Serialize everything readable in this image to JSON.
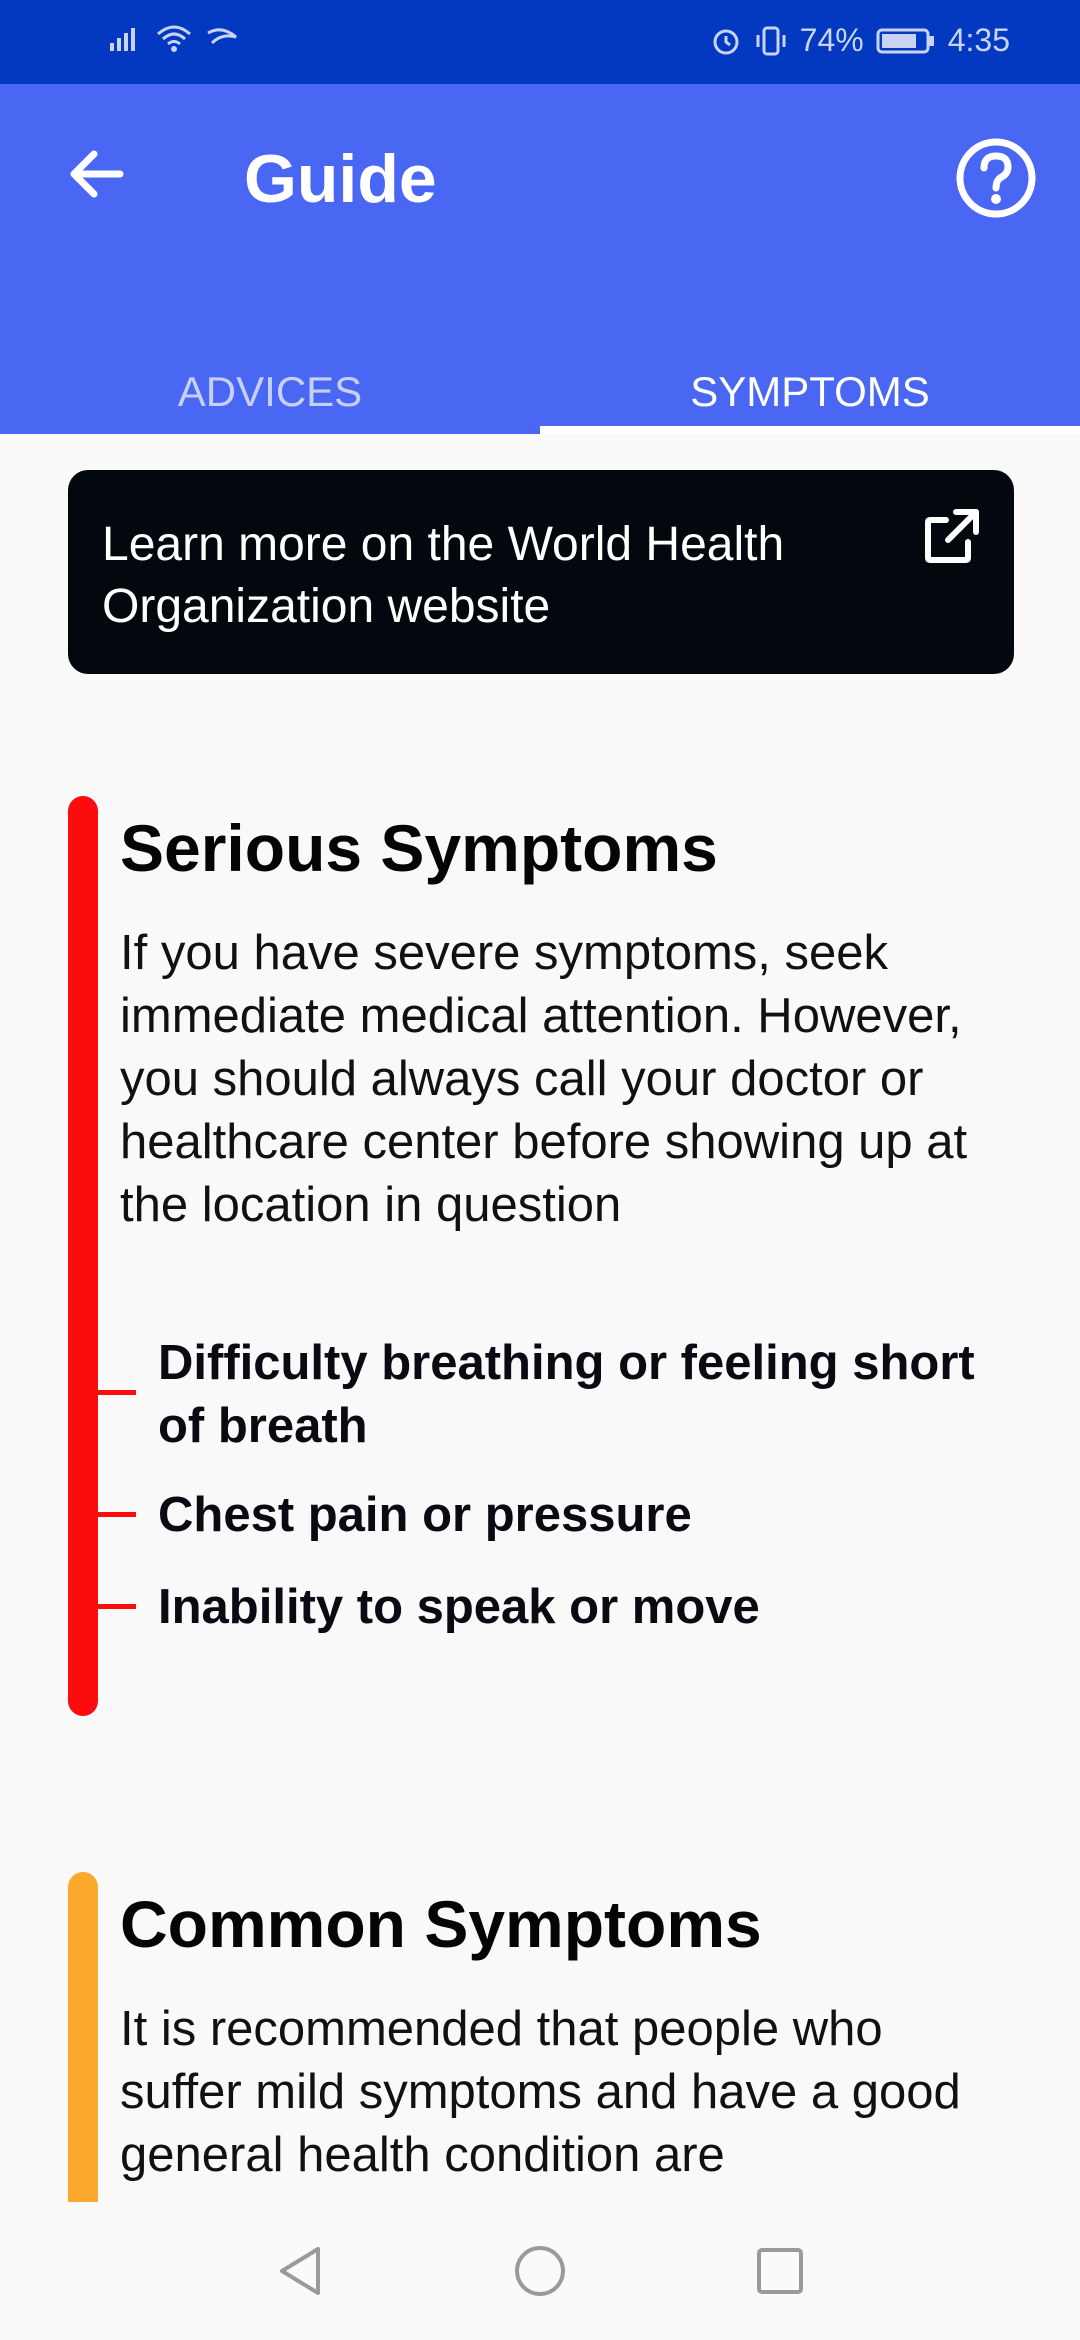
{
  "status": {
    "battery": "74%",
    "time": "4:35"
  },
  "appbar": {
    "title": "Guide"
  },
  "tabs": [
    {
      "label": "ADVICES",
      "active": false
    },
    {
      "label": "SYMPTOMS",
      "active": true
    }
  ],
  "who_card": {
    "text": "Learn more on the World Health Organization website"
  },
  "serious": {
    "title": "Serious Symptoms",
    "text": "If you have severe symptoms, seek immediate medical attention. However, you should always call your doctor or healthcare center before showing up at the location in question",
    "items": [
      "Difficulty breathing or feeling short of breath",
      "Chest pain or pressure",
      "Inability to speak or move"
    ],
    "color": "#fc0d0d"
  },
  "common": {
    "title": "Common Symptoms",
    "text": "It is recommended that people who suffer mild symptoms and have a good general health condition are",
    "color": "#fbaa2e"
  },
  "colors": {
    "status_bar": "#0338c0",
    "app_bar": "#4a67f4"
  },
  "icons": {
    "back": "arrow-left-icon",
    "help": "help-circle-icon",
    "external": "external-link-icon"
  }
}
